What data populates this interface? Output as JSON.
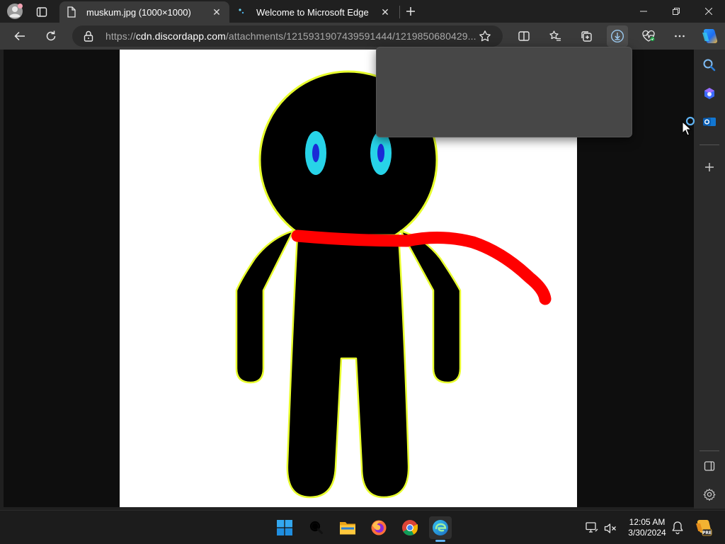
{
  "tabs": [
    {
      "title": "muskum.jpg (1000×1000)",
      "active": true
    },
    {
      "title": "Welcome to Microsoft Edge",
      "active": false
    }
  ],
  "address": {
    "url_scheme": "https://",
    "url_host": "cdn.discordapp.com",
    "url_path": "/attachments/1215931907439591444/1219850680429..."
  },
  "clock": {
    "time": "12:05 AM",
    "date": "3/30/2024"
  },
  "colors": {
    "accent": "#5fb2f2",
    "figure_outline": "#e8ff2e",
    "eye_outer": "#27d3e8",
    "eye_inner": "#1a2bd6",
    "scarf": "#ff0000"
  },
  "icons": {
    "profile": "profile-avatar-icon",
    "tab_actions": "tab-actions-icon",
    "new_tab": "plus-icon",
    "back": "arrow-left-icon",
    "refresh": "refresh-icon",
    "lock": "lock-icon",
    "favorite": "star-icon",
    "split": "split-screen-icon",
    "favorites": "favorites-icon",
    "collections": "collections-icon",
    "downloads": "download-icon",
    "health": "browser-essentials-icon",
    "more": "more-icon",
    "copilot": "copilot-icon"
  }
}
